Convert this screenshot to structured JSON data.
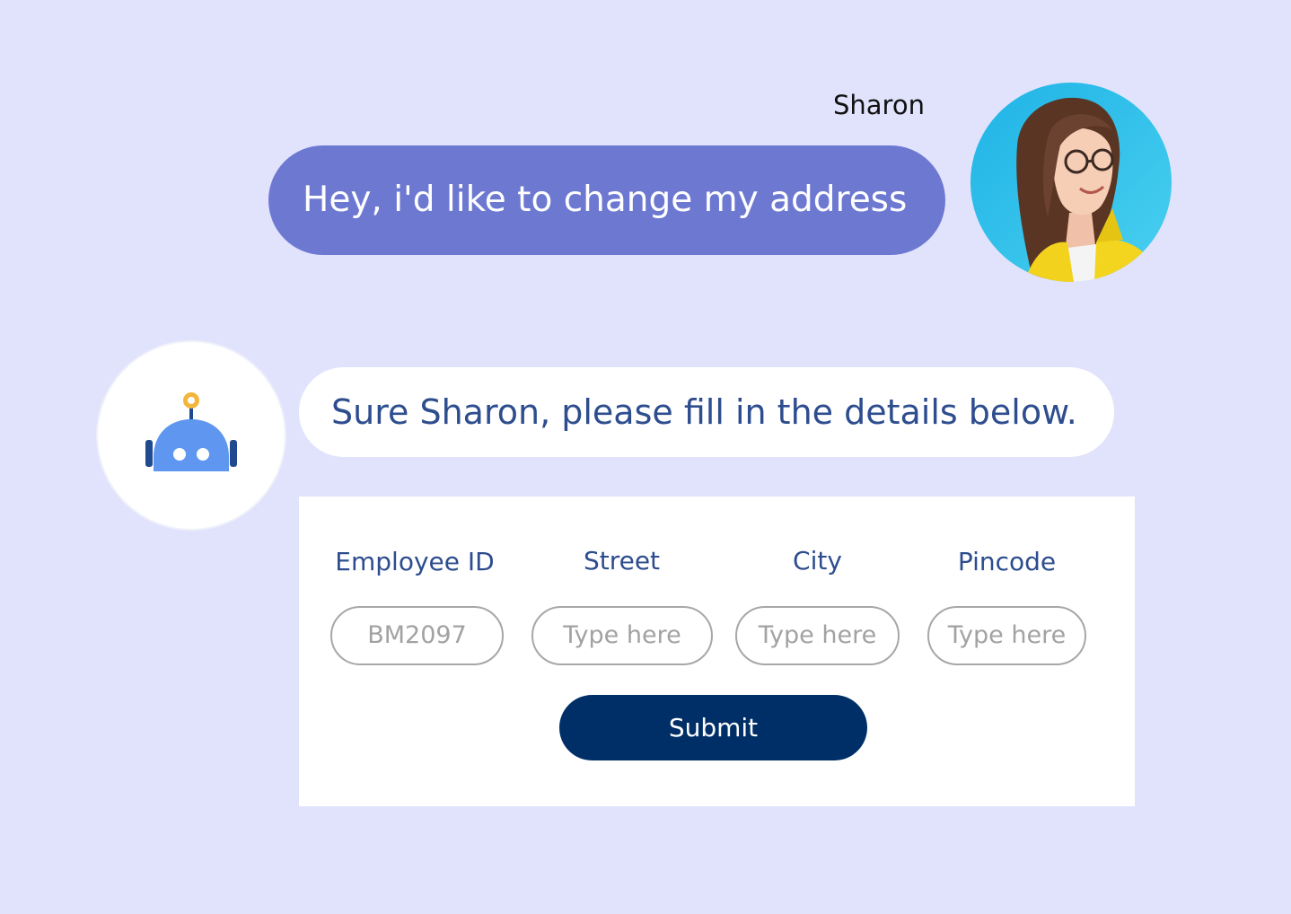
{
  "colors": {
    "background": "#e1e3fd",
    "user_bubble": "#6d79d1",
    "bot_text": "#2d4d8e",
    "submit_button": "#002f67",
    "input_border": "#a7a7a7",
    "placeholder": "#a2a2a2"
  },
  "user": {
    "name": "Sharon",
    "avatar_icon": "user-avatar-photo",
    "message": "Hey, i'd like to change my address"
  },
  "bot": {
    "avatar_icon": "robot-icon",
    "message": "Sure Sharon, please fill in the details below."
  },
  "form": {
    "fields": [
      {
        "label": "Employee ID",
        "value": "BM2097",
        "placeholder": ""
      },
      {
        "label": "Street",
        "value": "",
        "placeholder": "Type here"
      },
      {
        "label": "City",
        "value": "",
        "placeholder": "Type here"
      },
      {
        "label": "Pincode",
        "value": "",
        "placeholder": "Type here"
      }
    ],
    "submit_label": "Submit"
  }
}
